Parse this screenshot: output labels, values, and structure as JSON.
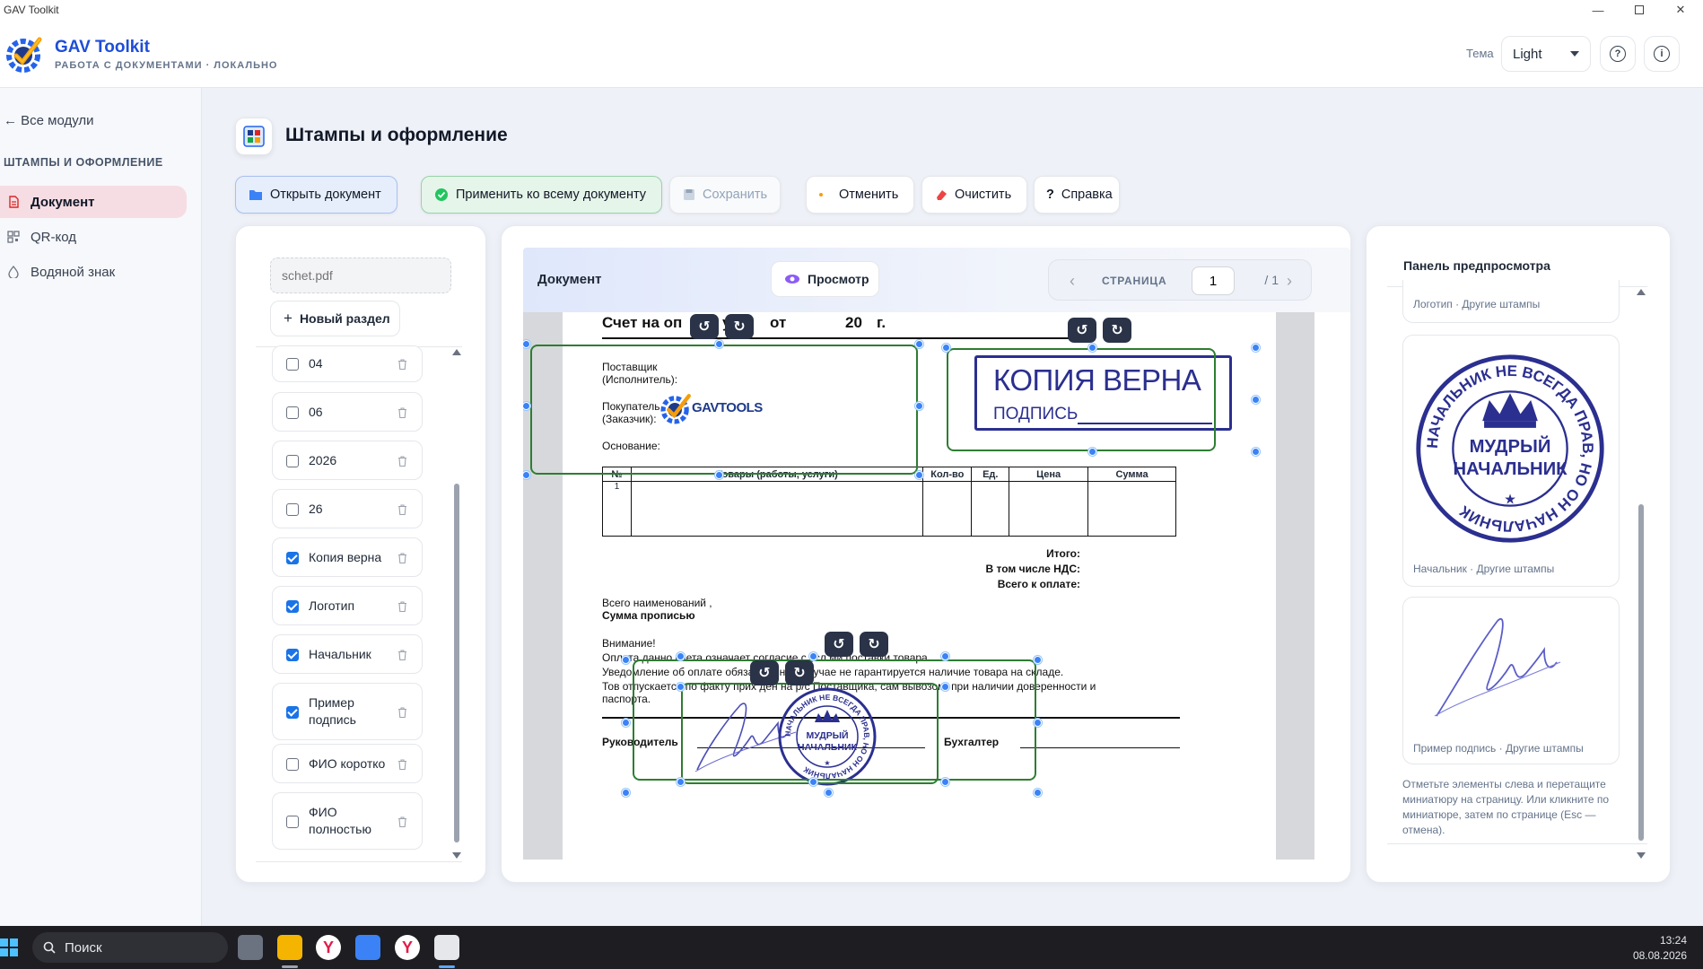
{
  "window": {
    "title": "GAV Toolkit"
  },
  "header": {
    "app_name": "GAV Toolkit",
    "subtitle": "РАБОТА С ДОКУМЕНТАМИ · ЛОКАЛЬНО",
    "theme_label": "Тема",
    "theme_value": "Light",
    "help_glyph": "?",
    "info_glyph": "i"
  },
  "sidebar": {
    "back_label": "← Все модули",
    "section_title": "ШТАМПЫ И ОФОРМЛЕНИЕ",
    "items": [
      {
        "label": "Документ",
        "icon": "document-icon",
        "active": true
      },
      {
        "label": "QR-код",
        "icon": "qr-icon",
        "active": false
      },
      {
        "label": "Водяной знак",
        "icon": "drop-icon",
        "active": false
      }
    ]
  },
  "main": {
    "title": "Штампы и оформление",
    "toolbar": {
      "open": "Открыть документ",
      "apply_all": "Применить ко всему документу",
      "save": "Сохранить",
      "undo": "Отменить",
      "clear": "Очистить",
      "help": "Справка",
      "help_glyph": "?"
    }
  },
  "left_panel": {
    "file_placeholder": "schet.pdf",
    "new_section": "Новый раздел",
    "stamps": [
      {
        "label": "04",
        "checked": false
      },
      {
        "label": "06",
        "checked": false
      },
      {
        "label": "2026",
        "checked": false
      },
      {
        "label": "26",
        "checked": false
      },
      {
        "label": "Копия верна",
        "checked": true
      },
      {
        "label": "Логотип",
        "checked": true
      },
      {
        "label": "Начальник",
        "checked": true
      },
      {
        "label": "Пример подпись",
        "checked": true
      },
      {
        "label": "ФИО коротко",
        "checked": false
      },
      {
        "label": "ФИО полностью",
        "checked": false
      }
    ]
  },
  "document": {
    "label": "Документ",
    "preview_btn": "Просмотр",
    "page_label": "СТРАНИЦА",
    "page_current": "1",
    "page_total": "/ 1",
    "content": {
      "title": "Счет на оп",
      "title_mid": "у",
      "title_from": "от",
      "title_year": "20",
      "title_g": "г.",
      "supplier": "Поставщик",
      "supplier_sub": "(Исполнитель):",
      "buyer": "Покупатель",
      "buyer_sub": "(Заказчик):",
      "basis": "Основание:",
      "table_headers": [
        "№",
        "Товары (работы, услуги)",
        "Кол-во",
        "Ед.",
        "Цена",
        "Сумма"
      ],
      "row_num": "1",
      "total": "Итого:",
      "vat": "В том числе НДС:",
      "to_pay": "Всего к оплате:",
      "count": "Всего наименований ,",
      "in_words": "Сумма прописью",
      "attention": "Внимание!",
      "line1": "Оплата данно     счета означает согласие с усл     ми поставки товара.",
      "line2": "Уведомление об оплате обяза                 отивном случае не гарантируется наличие товара на складе.",
      "line3": "Тов      отпускается по факту прих      ден     на р/с Поставщика, сам     вывозом, при наличии доверенности и",
      "line4": "паспорта.",
      "manager": "Руководитель",
      "accountant": "Бухгалтер"
    },
    "stamp_kopia": {
      "big": "КОПИЯ ВЕРНА",
      "small": "ПОДПИСЬ"
    },
    "logo_text": "GAVTOOLS",
    "seal": {
      "ring_text": "НАЧАЛЬНИК НЕ ВСЕГДА ПРАВ, НО ОН НАЧАЛЬНИК",
      "line1": "МУДРЫЙ",
      "line2": "НАЧАЛЬНИК"
    },
    "rotate_left": "↺",
    "rotate_right": "↻"
  },
  "preview_panel": {
    "title": "Панель предпросмотра",
    "cards": [
      {
        "caption": "Логотип · Другие штампы"
      },
      {
        "caption": "Начальник · Другие штампы"
      },
      {
        "caption": "Пример подпись · Другие штампы"
      }
    ],
    "hint": "Отметьте элементы слева и перетащите миниатюру на страницу. Или кликните по миниатюре, затем по странице (Esc — отмена)."
  },
  "taskbar": {
    "search": "Поиск",
    "time": "13:24",
    "date": "08.08.2026"
  },
  "colors": {
    "accent_blue": "#1d4ed8",
    "selection_green": "#2e7d32",
    "stamp_navy": "#2b2f8f",
    "active_nav": "#f6dde3"
  }
}
